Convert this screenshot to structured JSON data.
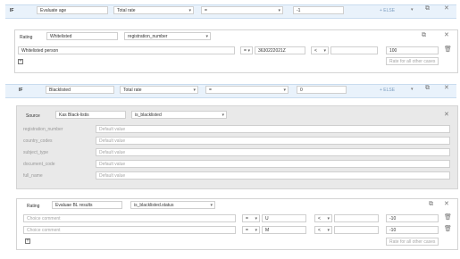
{
  "if_block_1": {
    "keyword": "IF",
    "name": "Evaluate age",
    "metric": "Total rate",
    "operator": "=",
    "value": "-1",
    "else_label": "+ ELSE"
  },
  "rating_1": {
    "label": "Rating",
    "name": "Whitelisted",
    "field": "registration_number",
    "row": {
      "comment": "Whitelisted person",
      "operator": "=",
      "value": "3630222021Z",
      "operator2": "<",
      "value2": "",
      "result": "100"
    },
    "other_cases_placeholder": "Rate for all other cases"
  },
  "if_block_2": {
    "keyword": "IF",
    "name": "Blacklisted",
    "metric": "Total rate",
    "operator": "=",
    "value": "0",
    "else_label": "+ ELSE"
  },
  "source": {
    "label": "Source",
    "name": "Kas Black-listis",
    "field": "is_blacklisted",
    "params": [
      {
        "name": "registration_number",
        "placeholder": "Default value"
      },
      {
        "name": "country_codes",
        "placeholder": "Default value"
      },
      {
        "name": "subject_type",
        "placeholder": "Default value"
      },
      {
        "name": "document_code",
        "placeholder": "Default value"
      },
      {
        "name": "full_name",
        "placeholder": "Default value"
      }
    ]
  },
  "rating_2": {
    "label": "Rating",
    "name": "Evaluae BL results",
    "field": "is_blacklisted.status",
    "rows": [
      {
        "comment_placeholder": "Choice comment",
        "operator": "=",
        "value": "U",
        "operator2": "<",
        "result": "-10"
      },
      {
        "comment_placeholder": "Choice comment",
        "operator": "=",
        "value": "M",
        "operator2": "<",
        "result": "-10"
      }
    ],
    "other_cases_placeholder": "Rate for all other cases"
  },
  "icons": {
    "copy": "copy-icon",
    "close": "close-icon",
    "delete": "trash-icon",
    "add": "plus-icon",
    "dropdown": "chevron-down-icon"
  },
  "colors": {
    "if_row_bg": "#e9f2fb",
    "else_link": "#7d9ec0",
    "source_bg": "#e9e9e9"
  }
}
